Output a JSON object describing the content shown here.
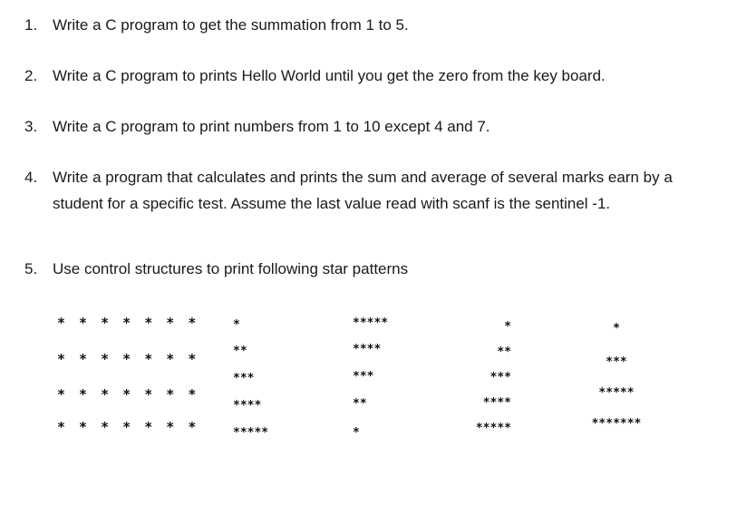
{
  "questions": [
    {
      "num": "1.",
      "text": "Write a C program to get the summation from 1 to 5."
    },
    {
      "num": "2.",
      "text": "Write a C program to prints Hello World until you get the zero from the key board."
    },
    {
      "num": "3.",
      "text": "Write a C program to print numbers from 1 to 10 except 4 and 7."
    },
    {
      "num": "4.",
      "text": "Write a program that calculates and prints the sum and average of several marks earn by a",
      "text2": "student for a specific test. Assume the last value read with scanf is the sentinel -1."
    },
    {
      "num": "5.",
      "text": "Use control structures to print following star patterns"
    }
  ],
  "patterns": {
    "square": [
      "* * * * * * *",
      "* * * * * * *",
      "* * * * * * *",
      "* * * * * * *"
    ],
    "increasing": [
      "*",
      "**",
      "***",
      "****",
      "*****"
    ],
    "decreasing": [
      "*****",
      "****",
      "***",
      "**",
      "*"
    ],
    "right_aligned": [
      "*",
      "**",
      "***",
      "****",
      "*****"
    ],
    "pyramid": [
      "*",
      "***",
      "*****",
      "*******"
    ]
  }
}
